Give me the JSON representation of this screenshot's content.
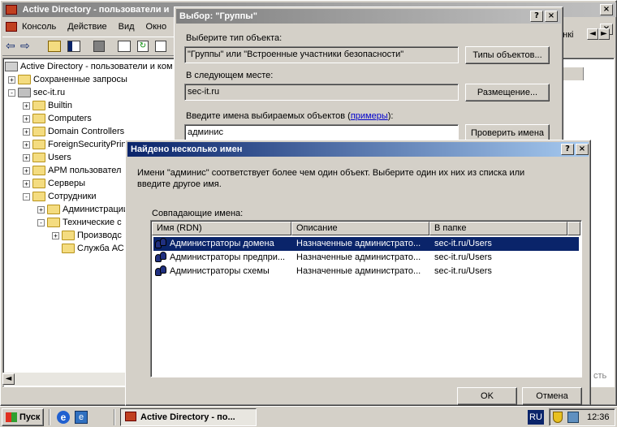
{
  "mmc": {
    "title": "Active Directory - пользователи и",
    "menu": [
      "Консоль",
      "Действие",
      "Вид",
      "Окно"
    ],
    "tree_root": "Active Directory - пользователи и ком",
    "tree": [
      {
        "label": "Сохраненные запросы",
        "level": 1,
        "pm": "+"
      },
      {
        "label": "sec-it.ru",
        "level": 1,
        "pm": "-"
      },
      {
        "label": "Builtin",
        "level": 2,
        "pm": "+"
      },
      {
        "label": "Computers",
        "level": 2,
        "pm": "+"
      },
      {
        "label": "Domain Controllers",
        "level": 2,
        "pm": "+"
      },
      {
        "label": "ForeignSecurityPrin",
        "level": 2,
        "pm": "+"
      },
      {
        "label": "Users",
        "level": 2,
        "pm": "+"
      },
      {
        "label": "АРМ пользовател",
        "level": 2,
        "pm": "+"
      },
      {
        "label": "Серверы",
        "level": 2,
        "pm": "+"
      },
      {
        "label": "Сотрудники",
        "level": 2,
        "pm": "-"
      },
      {
        "label": "Администрации",
        "level": 3,
        "pm": "+"
      },
      {
        "label": "Технические с",
        "level": 3,
        "pm": "-"
      },
      {
        "label": "Производс",
        "level": 4,
        "pm": "+"
      },
      {
        "label": "Служба АС",
        "level": 4,
        "pm": ""
      }
    ],
    "right_partial": "онкі",
    "right_partial2": "сть"
  },
  "select_dialog": {
    "title": "Выбор: \"Группы\"",
    "type_label": "Выберите тип объекта:",
    "type_value": "\"Группы\" или \"Встроенные участники безопасности\"",
    "type_button": "Типы объектов...",
    "location_label": "В следующем месте:",
    "location_value": "sec-it.ru",
    "location_button": "Размещение...",
    "names_label_prefix": "Введите имена выбираемых объектов (",
    "names_link": "примеры",
    "names_label_suffix": "):",
    "names_value": "админис",
    "check_button": "Проверить имена"
  },
  "found_dialog": {
    "title": "Найдено несколько имен",
    "message_line1": "Имени \"админис\" соответствует более чем один объект. Выберите один их них из списка или",
    "message_line2": "введите другое имя.",
    "list_label": "Совпадающие имена:",
    "columns": [
      "Имя (RDN)",
      "Описание",
      "В папке"
    ],
    "rows": [
      {
        "name": "Администраторы домена",
        "desc": "Назначенные администрато...",
        "folder": "sec-it.ru/Users",
        "selected": true
      },
      {
        "name": "Администраторы предпри...",
        "desc": "Назначенные администрато...",
        "folder": "sec-it.ru/Users",
        "selected": false
      },
      {
        "name": "Администраторы схемы",
        "desc": "Назначенные администрато...",
        "folder": "sec-it.ru/Users",
        "selected": false
      }
    ],
    "ok_button": "OK",
    "cancel_button": "Отмена"
  },
  "taskbar": {
    "start": "Пуск",
    "task": "Active Directory - по...",
    "lang": "RU",
    "time": "12:36"
  }
}
